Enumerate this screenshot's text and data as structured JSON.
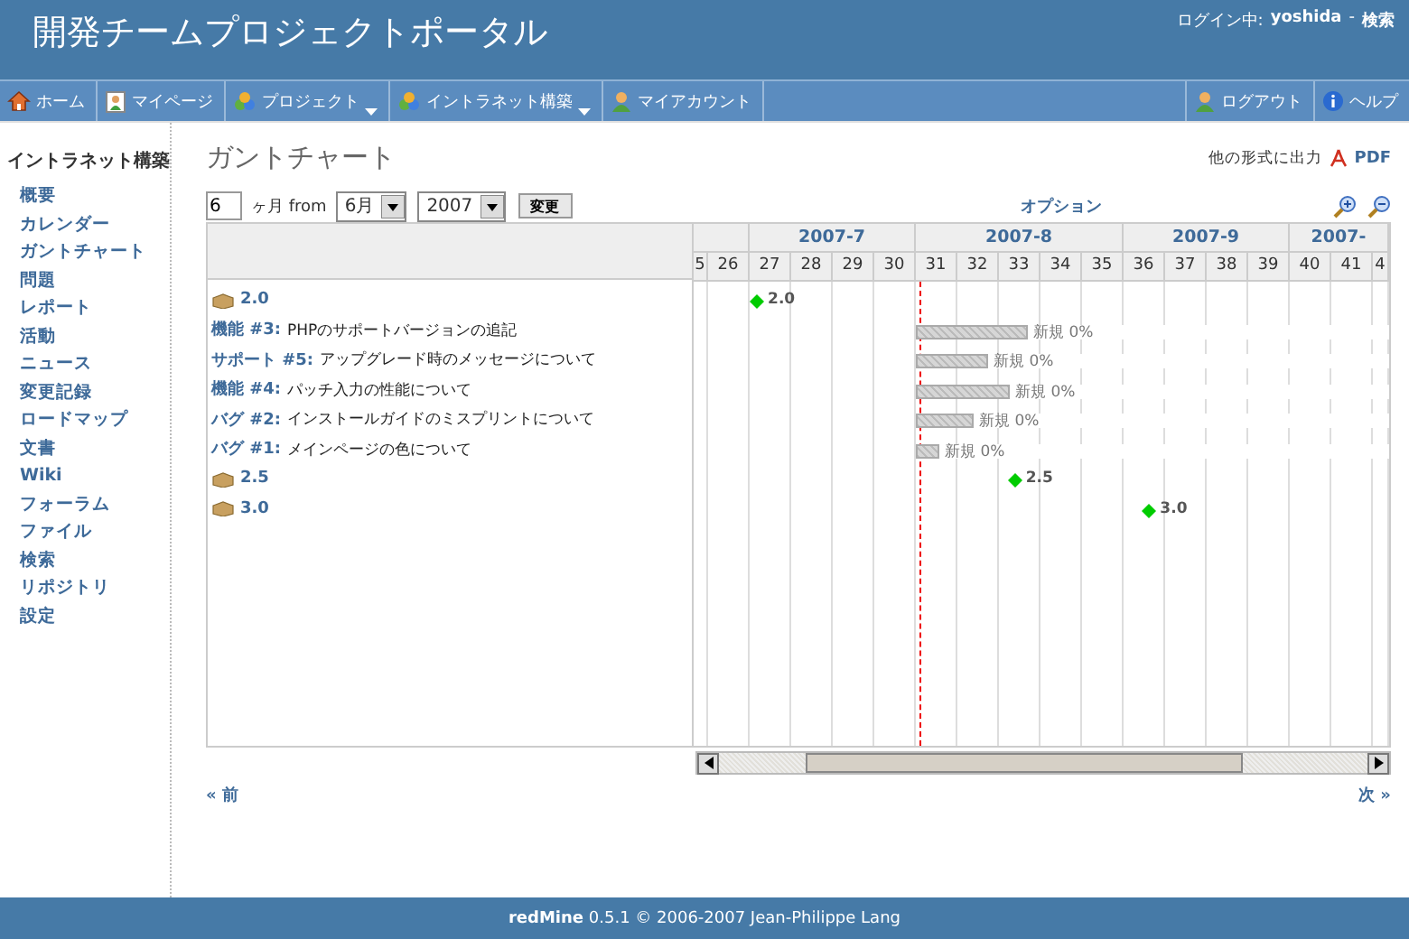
{
  "header": {
    "title": "開発チームプロジェクトポータル",
    "login_label": "ログイン中:",
    "user": "yoshida",
    "separator": "-",
    "search_link": "検索"
  },
  "menu": {
    "left": [
      {
        "label": "ホーム",
        "kind": "home",
        "dropdown": false
      },
      {
        "label": "マイページ",
        "kind": "page",
        "dropdown": false
      },
      {
        "label": "プロジェクト",
        "kind": "projects",
        "dropdown": true
      },
      {
        "label": "イントラネット構築",
        "kind": "projects",
        "dropdown": true
      },
      {
        "label": "マイアカウント",
        "kind": "person",
        "dropdown": false
      }
    ],
    "right": [
      {
        "label": "ログアウト",
        "kind": "person",
        "dropdown": false
      },
      {
        "label": "ヘルプ",
        "kind": "info",
        "dropdown": false
      }
    ]
  },
  "sidebar": {
    "title": "イントラネット構築",
    "items": [
      "概要",
      "カレンダー",
      "ガントチャート",
      "問題",
      "レポート",
      "活動",
      "ニュース",
      "変更記録",
      "ロードマップ",
      "文書",
      "Wiki",
      "フォーラム",
      "ファイル",
      "検索",
      "リポジトリ",
      "設定"
    ]
  },
  "page": {
    "title": "ガントチャート",
    "export_label": "他の形式に出力",
    "export_link": "PDF"
  },
  "filter": {
    "months": "6",
    "months_label": "ヶ月 from",
    "month": "6月",
    "year": "2007",
    "button": "変更",
    "options_link": "オプション"
  },
  "gantt": {
    "today": {
      "level": 0.325
    },
    "months": [
      {
        "weeks": [
          {
            "label": "5",
            "kind": "edge"
          },
          {
            "label": "26",
            "kind": "full"
          }
        ]
      },
      {
        "label": "2007-7",
        "weeks": [
          {
            "label": "27",
            "kind": "full"
          },
          {
            "label": "28",
            "kind": "full"
          },
          {
            "label": "29",
            "kind": "full"
          },
          {
            "label": "30",
            "kind": "full"
          }
        ]
      },
      {
        "label": "2007-8",
        "weeks": [
          {
            "label": "31",
            "kind": "full"
          },
          {
            "label": "32",
            "kind": "full"
          },
          {
            "label": "33",
            "kind": "full"
          },
          {
            "label": "34",
            "kind": "full"
          },
          {
            "label": "35",
            "kind": "full"
          }
        ]
      },
      {
        "label": "2007-9",
        "weeks": [
          {
            "label": "36",
            "kind": "full"
          },
          {
            "label": "37",
            "kind": "full"
          },
          {
            "label": "38",
            "kind": "full"
          },
          {
            "label": "39",
            "kind": "full"
          }
        ]
      },
      {
        "label": "2007-",
        "weeks": [
          {
            "label": "40",
            "kind": "full"
          },
          {
            "label": "41",
            "kind": "full"
          },
          {
            "label": "4",
            "kind": "edge"
          }
        ]
      }
    ],
    "rows": [
      {
        "kind": "version",
        "label": "2.0",
        "marker": {
          "level": 0.091
        },
        "marker_label": "2.0"
      },
      {
        "kind": "issue",
        "tracker": "機能 #3:",
        "subject": "PHPのサポートバージョンの追記",
        "span": {
          "level": 0.237
        },
        "status": "新規 0%"
      },
      {
        "kind": "issue",
        "tracker": "サポート #5:",
        "subject": "アップグレード時のメッセージについて",
        "span": {
          "level": 0.153
        },
        "status": "新規 0%"
      },
      {
        "kind": "issue",
        "tracker": "機能 #4:",
        "subject": "パッチ入力の性能について",
        "span": {
          "level": 0.198
        },
        "status": "新規 0%"
      },
      {
        "kind": "issue",
        "tracker": "バグ #2:",
        "subject": "インストールガイドのミスプリントについて",
        "span": {
          "level": 0.122
        },
        "status": "新規 0%"
      },
      {
        "kind": "issue",
        "tracker": "バグ #1:",
        "subject": "メインページの色について",
        "span": {
          "level": 0.05
        },
        "status": "新規 0%"
      },
      {
        "kind": "version",
        "label": "2.5",
        "marker": {
          "level": 0.462
        },
        "marker_label": "2.5"
      },
      {
        "kind": "version",
        "label": "3.0",
        "marker": {
          "level": 0.655
        },
        "marker_label": "3.0"
      }
    ]
  },
  "nav": {
    "previous": "« 前",
    "next": "次 »"
  },
  "footer": "**redMine** 0.5.1 © 2006-2007 Jean-Philippe Lang"
}
